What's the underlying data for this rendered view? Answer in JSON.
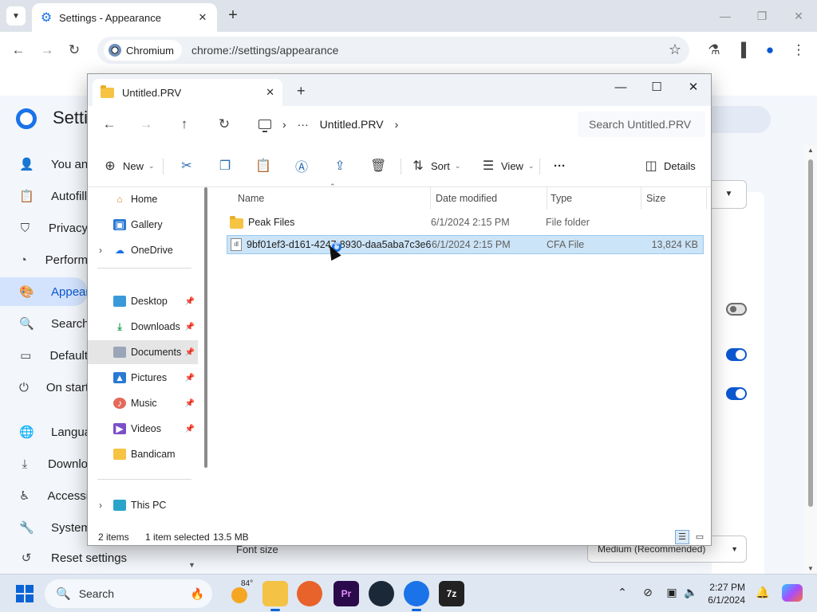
{
  "browser": {
    "tab_title": "Settings - Appearance",
    "site_chip": "Chromium",
    "url": "chrome://settings/appearance"
  },
  "settings": {
    "title_fragment": "Setti",
    "nav": [
      {
        "label": "You and",
        "icon": "person-icon"
      },
      {
        "label": "Autofill",
        "icon": "clipboard-icon"
      },
      {
        "label": "Privacy",
        "icon": "shield-icon"
      },
      {
        "label": "Perform",
        "icon": "gauge-icon"
      },
      {
        "label": "Appeara",
        "icon": "palette-icon",
        "active": true
      },
      {
        "label": "Search",
        "icon": "search-icon"
      },
      {
        "label": "Default",
        "icon": "browser-icon"
      },
      {
        "label": "On start",
        "icon": "power-icon"
      },
      {
        "label": "Langua",
        "icon": "globe-icon"
      },
      {
        "label": "Downlo",
        "icon": "download-icon"
      },
      {
        "label": "Accessi",
        "icon": "accessibility-icon"
      },
      {
        "label": "System",
        "icon": "wrench-icon"
      }
    ],
    "reset_label": "Reset settings",
    "font_size_label": "Font size",
    "font_size_value": "Medium (Recommended)"
  },
  "explorer": {
    "tab_title": "Untitled.PRV",
    "breadcrumb": {
      "ellipsis": "···",
      "folder": "Untitled.PRV"
    },
    "search_placeholder": "Search Untitled.PRV",
    "commands": {
      "new": "New",
      "sort": "Sort",
      "view": "View",
      "more": "···",
      "details": "Details"
    },
    "nav": {
      "home": "Home",
      "gallery": "Gallery",
      "onedrive": "OneDrive",
      "desktop": "Desktop",
      "downloads": "Downloads",
      "documents": "Documents",
      "pictures": "Pictures",
      "music": "Music",
      "videos": "Videos",
      "bandicam": "Bandicam",
      "thispc": "This PC"
    },
    "columns": {
      "name": "Name",
      "date": "Date modified",
      "type": "Type",
      "size": "Size"
    },
    "files": [
      {
        "name": "Peak Files",
        "date": "6/1/2024 2:15 PM",
        "type": "File folder",
        "size": ""
      },
      {
        "name": "9bf01ef3-d161-4247-8930-daa5aba7c3e6...",
        "date": "6/1/2024 2:15 PM",
        "type": "CFA File",
        "size": "13,824 KB"
      }
    ],
    "status": {
      "items": "2 items",
      "selected": "1 item selected",
      "size": "13.5 MB"
    }
  },
  "taskbar": {
    "search_label": "Search",
    "temperature": "84°",
    "time": "2:27 PM",
    "date": "6/1/2024"
  },
  "colors": {
    "accent": "#0b57d0",
    "selection": "#cce4f7",
    "folder": "#f6c343"
  }
}
